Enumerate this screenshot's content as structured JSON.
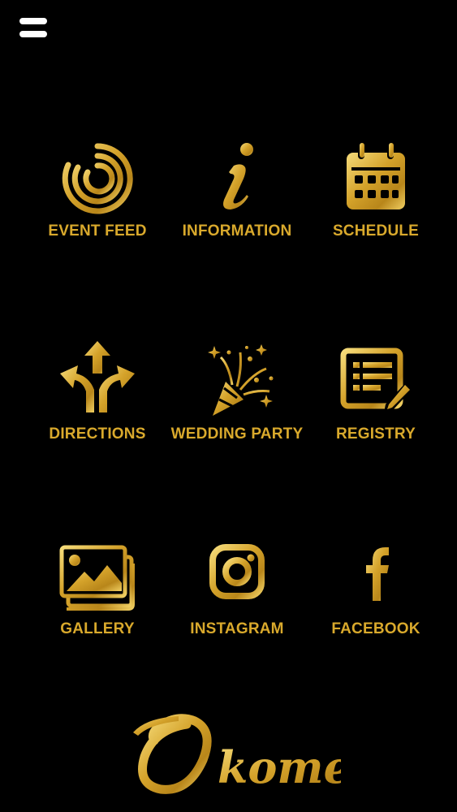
{
  "menu": {
    "icon": "hamburger-menu-icon",
    "color": "#ffffff"
  },
  "theme": {
    "background": "#000000",
    "gold": "#d9a92c",
    "gold_light": "#f3d36a",
    "gold_dark": "#9a6b12"
  },
  "tiles": [
    {
      "id": "event-feed",
      "label": "EVENT FEED",
      "icon": "radar-rings-icon"
    },
    {
      "id": "information",
      "label": "INFORMATION",
      "icon": "info-i-icon"
    },
    {
      "id": "schedule",
      "label": "SCHEDULE",
      "icon": "calendar-icon"
    },
    {
      "id": "directions",
      "label": "DIRECTIONS",
      "icon": "split-arrows-icon"
    },
    {
      "id": "wedding-party",
      "label": "WEDDING PARTY",
      "icon": "party-popper-icon"
    },
    {
      "id": "registry",
      "label": "REGISTRY",
      "icon": "list-with-pencil-icon"
    },
    {
      "id": "gallery",
      "label": "GALLERY",
      "icon": "photo-stack-icon"
    },
    {
      "id": "instagram",
      "label": "INSTAGRAM",
      "icon": "instagram-icon"
    },
    {
      "id": "facebook",
      "label": "FACEBOOK",
      "icon": "facebook-f-icon"
    }
  ],
  "logo": {
    "text_initial": "O",
    "text_rest": "komes"
  }
}
